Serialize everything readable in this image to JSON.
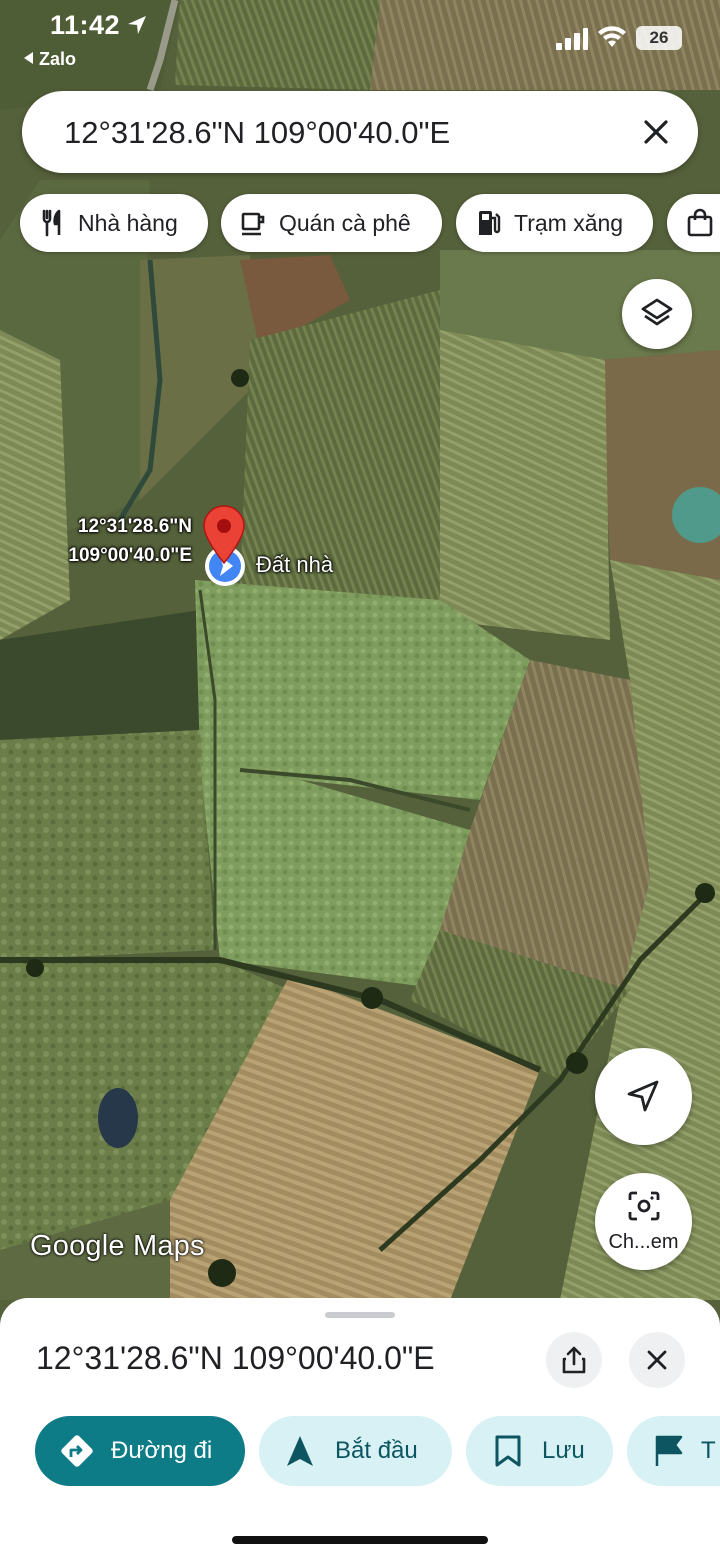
{
  "status_bar": {
    "time": "11:42",
    "back_app": "Zalo",
    "battery": "26"
  },
  "search": {
    "query": "12°31'28.6\"N 109°00'40.0\"E",
    "clear_icon": "close-icon"
  },
  "chips": [
    {
      "label": "Nhà hàng",
      "icon": "restaurant-icon"
    },
    {
      "label": "Quán cà phê",
      "icon": "coffee-icon"
    },
    {
      "label": "Trạm xăng",
      "icon": "gas-station-icon"
    },
    {
      "label": "",
      "icon": "shopping-bag-icon"
    }
  ],
  "map": {
    "pin_coords_line1": "12°31'28.6\"N",
    "pin_coords_line2": "109°00'40.0\"E",
    "saved_place_label": "Đất nhà",
    "brand": "Google Maps",
    "layers_icon": "layers-icon",
    "recenter_icon": "navigation-arrow-icon",
    "lens_icon": "camera-lens-icon",
    "lens_label": "Ch...em",
    "pin_color": "#ea4335",
    "place_dot_color": "#4285f4"
  },
  "sheet": {
    "title": "12°31'28.6\"N 109°00'40.0\"E",
    "share_icon": "share-icon",
    "close_icon": "close-icon",
    "actions": [
      {
        "label": "Đường đi",
        "icon": "directions-icon",
        "style": "primary"
      },
      {
        "label": "Bắt đầu",
        "icon": "navigation-icon",
        "style": "secondary"
      },
      {
        "label": "Lưu",
        "icon": "bookmark-icon",
        "style": "secondary"
      },
      {
        "label": "T",
        "icon": "flag-icon",
        "style": "secondary"
      }
    ]
  },
  "colors": {
    "primary_action": "#0d7c87",
    "secondary_action": "#d7f1f5",
    "text": "#202124"
  }
}
